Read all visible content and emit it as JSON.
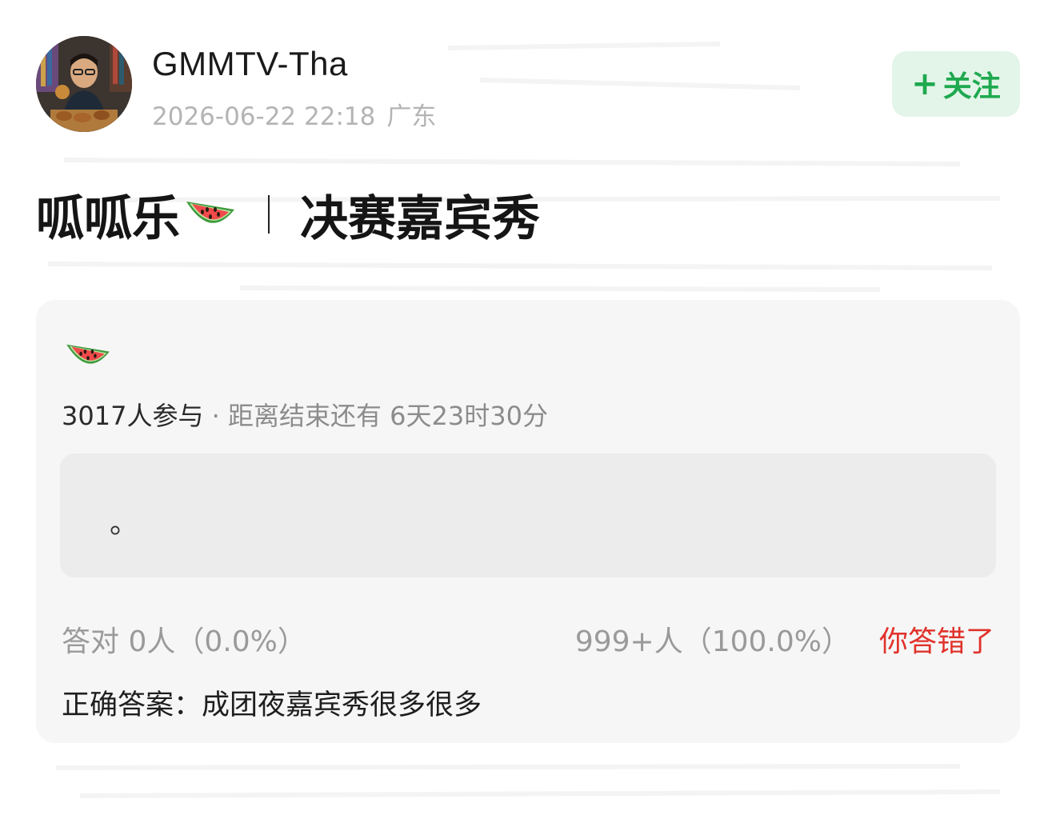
{
  "author": {
    "name": "GMMTV-Tha",
    "date": "2026-06-22 22:18",
    "location": "广东"
  },
  "follow": {
    "plus": "+",
    "label": "关注"
  },
  "post": {
    "title_part1": "呱呱乐",
    "title_part2": "决赛嘉宾秀"
  },
  "quiz": {
    "participants": "3017人参与",
    "dot": "·",
    "remaining_label": "距离结束还有",
    "remaining_time": "6天23时30分",
    "option_text": "。",
    "correct_label": "答对",
    "correct_count": "0人（0.0%）",
    "other_count": "999+人（100.0%）",
    "result_status": "你答错了",
    "answer_label": "正确答案：",
    "answer_text": "成团夜嘉宾秀很多很多"
  },
  "colors": {
    "accent_green": "#1ea94f",
    "follow_bg": "#e3f5e8",
    "error_red": "#e0322b",
    "card_bg": "#f6f6f6"
  },
  "icons": {
    "watermelon": "watermelon-icon",
    "avatar": "user-avatar"
  }
}
